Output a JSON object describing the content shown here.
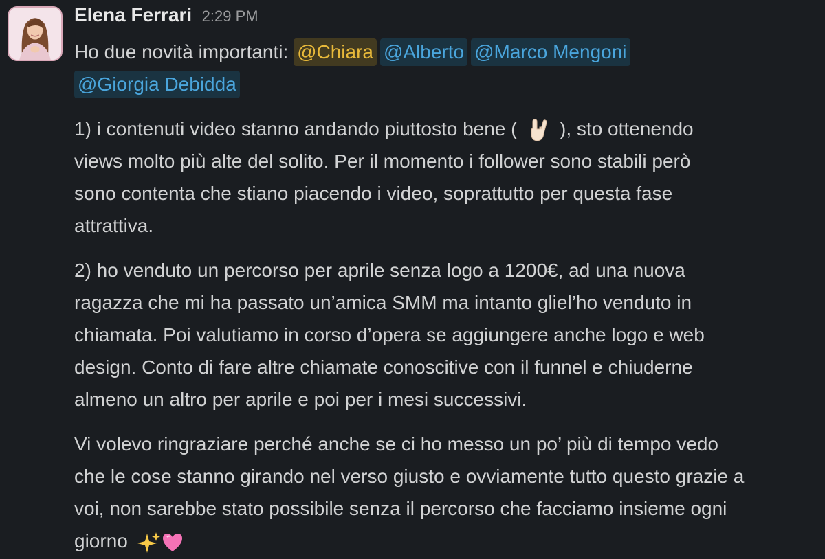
{
  "message": {
    "sender": "Elena Ferrari",
    "timestamp": "2:29 PM",
    "intro_text": "Ho due novità importanti:",
    "mentions": [
      "@Chiara",
      "@Alberto",
      "@Marco Mengoni",
      "@Giorgia Debidda"
    ],
    "p1": {
      "l1_before": "1) i contenuti video stanno andando piuttosto bene (",
      "l1_after": "), sto ottenendo",
      "l2": "views molto più alte del solito. Per il momento i follower sono stabili però",
      "l3": "sono contenta che stiano piacendo i video, soprattutto per questa fase",
      "l4": "attrattiva."
    },
    "p2": {
      "l1": "2) ho venduto un percorso per aprile senza logo a 1200€, ad una nuova",
      "l2": "ragazza che mi ha passato un’amica SMM ma intanto gliel’ho venduto in",
      "l3": "chiamata. Poi valutiamo in corso d’opera se aggiungere anche logo e web",
      "l4": "design. Conto di fare altre chiamate conoscitive con il funnel e chiuderne",
      "l5": "almeno un altro per aprile e poi per i mesi successivi."
    },
    "p3": {
      "l1": "Vi volevo ringraziare perché anche se ci ho messo un po’ più di tempo vedo",
      "l2": "che le cose stanno girando nel verso giusto e ovviamente tutto questo grazie a",
      "l3": "voi, non sarebbe stato possibile senza il percorso che facciamo insieme ogni",
      "l4": "giorno"
    },
    "emojis": [
      "rock-hand-emoji",
      "sparkles-emoji",
      "pink-heart-emoji"
    ]
  },
  "colors": {
    "background": "#1a1d21",
    "mention_self": "#e8b93a",
    "mention_other": "#4aa5dc"
  }
}
